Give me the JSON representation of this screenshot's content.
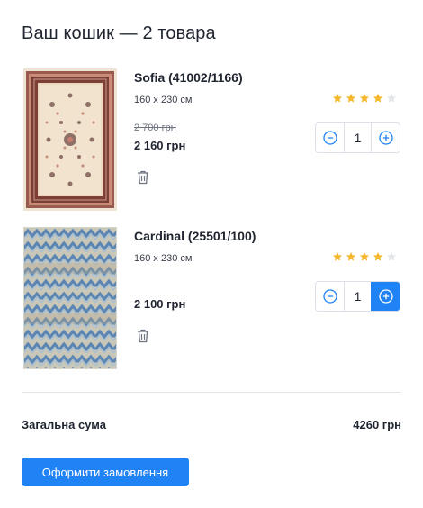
{
  "cart": {
    "title": "Ваш кошик — 2 товара",
    "total_label": "Загальна сума",
    "total_value": "4260 грн",
    "checkout_label": "Оформити замовлення"
  },
  "items": [
    {
      "name": "Sofia (41002/1166)",
      "size": "160 x 230 см",
      "old_price": "2 700 грн",
      "price": "2 160 грн",
      "rating": 4,
      "rating_max": 5,
      "quantity": "1"
    },
    {
      "name": "Cardinal (25501/100)",
      "size": "160 x 230 см",
      "price": "2 100 грн",
      "rating": 4,
      "rating_max": 5,
      "quantity": "1"
    }
  ],
  "icons": {
    "minus": "minus-circle-icon",
    "plus": "plus-circle-icon",
    "trash": "trash-icon",
    "star": "star-icon"
  },
  "colors": {
    "accent": "#1f82f5",
    "star_filled": "#f5b82e",
    "star_empty": "#e4e6ea"
  }
}
